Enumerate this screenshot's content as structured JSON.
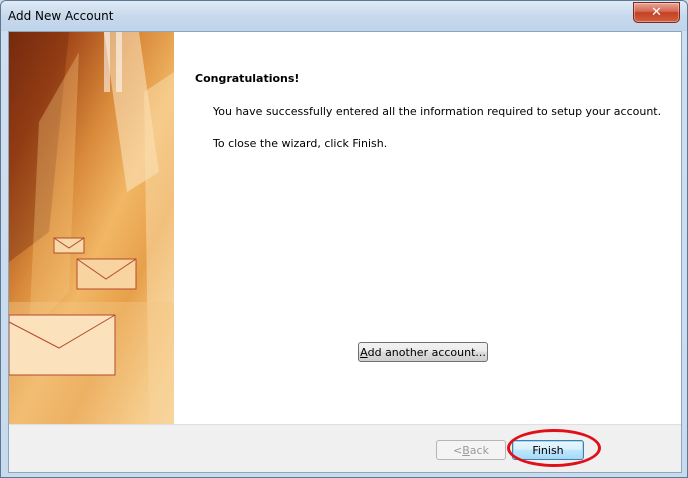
{
  "window": {
    "title": "Add New Account",
    "close_glyph": "✕"
  },
  "content": {
    "heading": "Congratulations!",
    "line1": "You have successfully entered all the information required to setup your account.",
    "line2": "To close the wizard, click Finish."
  },
  "buttons": {
    "add_another_prefix": "A",
    "add_another_rest": "dd another account...",
    "back_prefix": "< ",
    "back_underlined": "B",
    "back_rest": "ack",
    "finish": "Finish"
  },
  "colors": {
    "highlight": "#e0101a",
    "accent": "#3c7fb1"
  },
  "icons": [
    "close-icon",
    "envelope-icon"
  ]
}
